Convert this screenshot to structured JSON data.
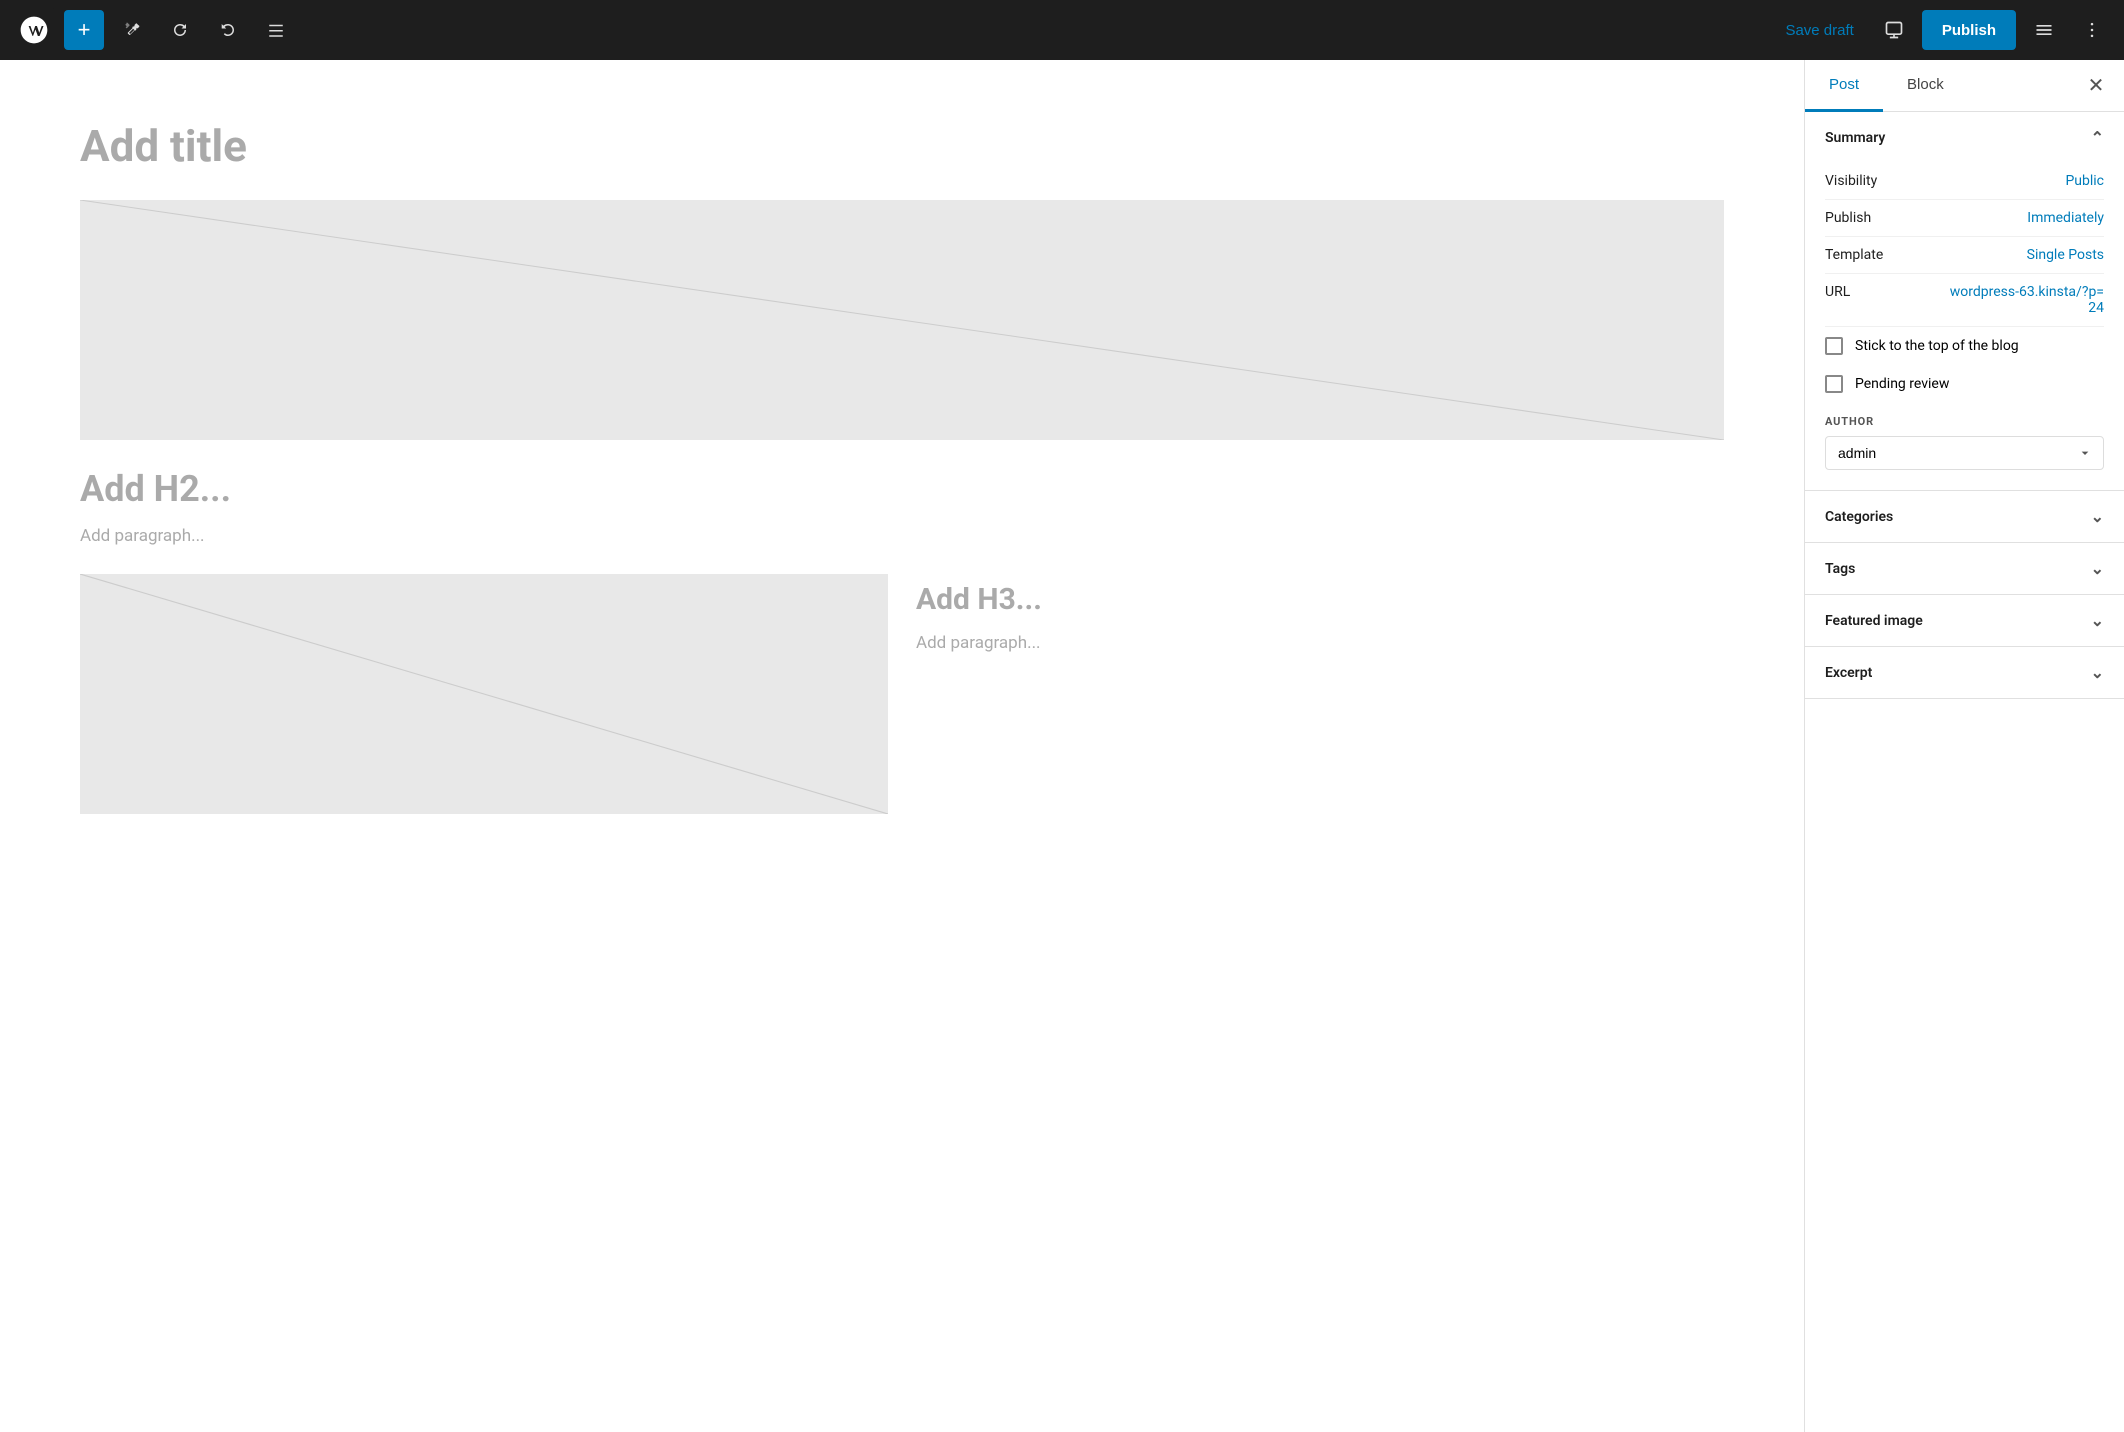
{
  "topbar": {
    "add_label": "+",
    "save_draft_label": "Save draft",
    "publish_label": "Publish"
  },
  "editor": {
    "title_placeholder": "Add title",
    "h2_placeholder": "Add H2...",
    "paragraph_placeholder": "Add paragraph...",
    "h3_placeholder": "Add H3...",
    "paragraph2_placeholder": "Add paragraph..."
  },
  "sidebar": {
    "post_tab": "Post",
    "block_tab": "Block",
    "summary_section": "Summary",
    "visibility_label": "Visibility",
    "visibility_value": "Public",
    "publish_label": "Publish",
    "publish_value": "Immediately",
    "template_label": "Template",
    "template_value": "Single Posts",
    "url_label": "URL",
    "url_value": "wordpress-63.kinsta/?p=24",
    "stick_top_label": "Stick to the top of the blog",
    "pending_review_label": "Pending review",
    "author_label": "AUTHOR",
    "author_value": "admin",
    "categories_label": "Categories",
    "tags_label": "Tags",
    "featured_image_label": "Featured image",
    "excerpt_label": "Excerpt"
  }
}
